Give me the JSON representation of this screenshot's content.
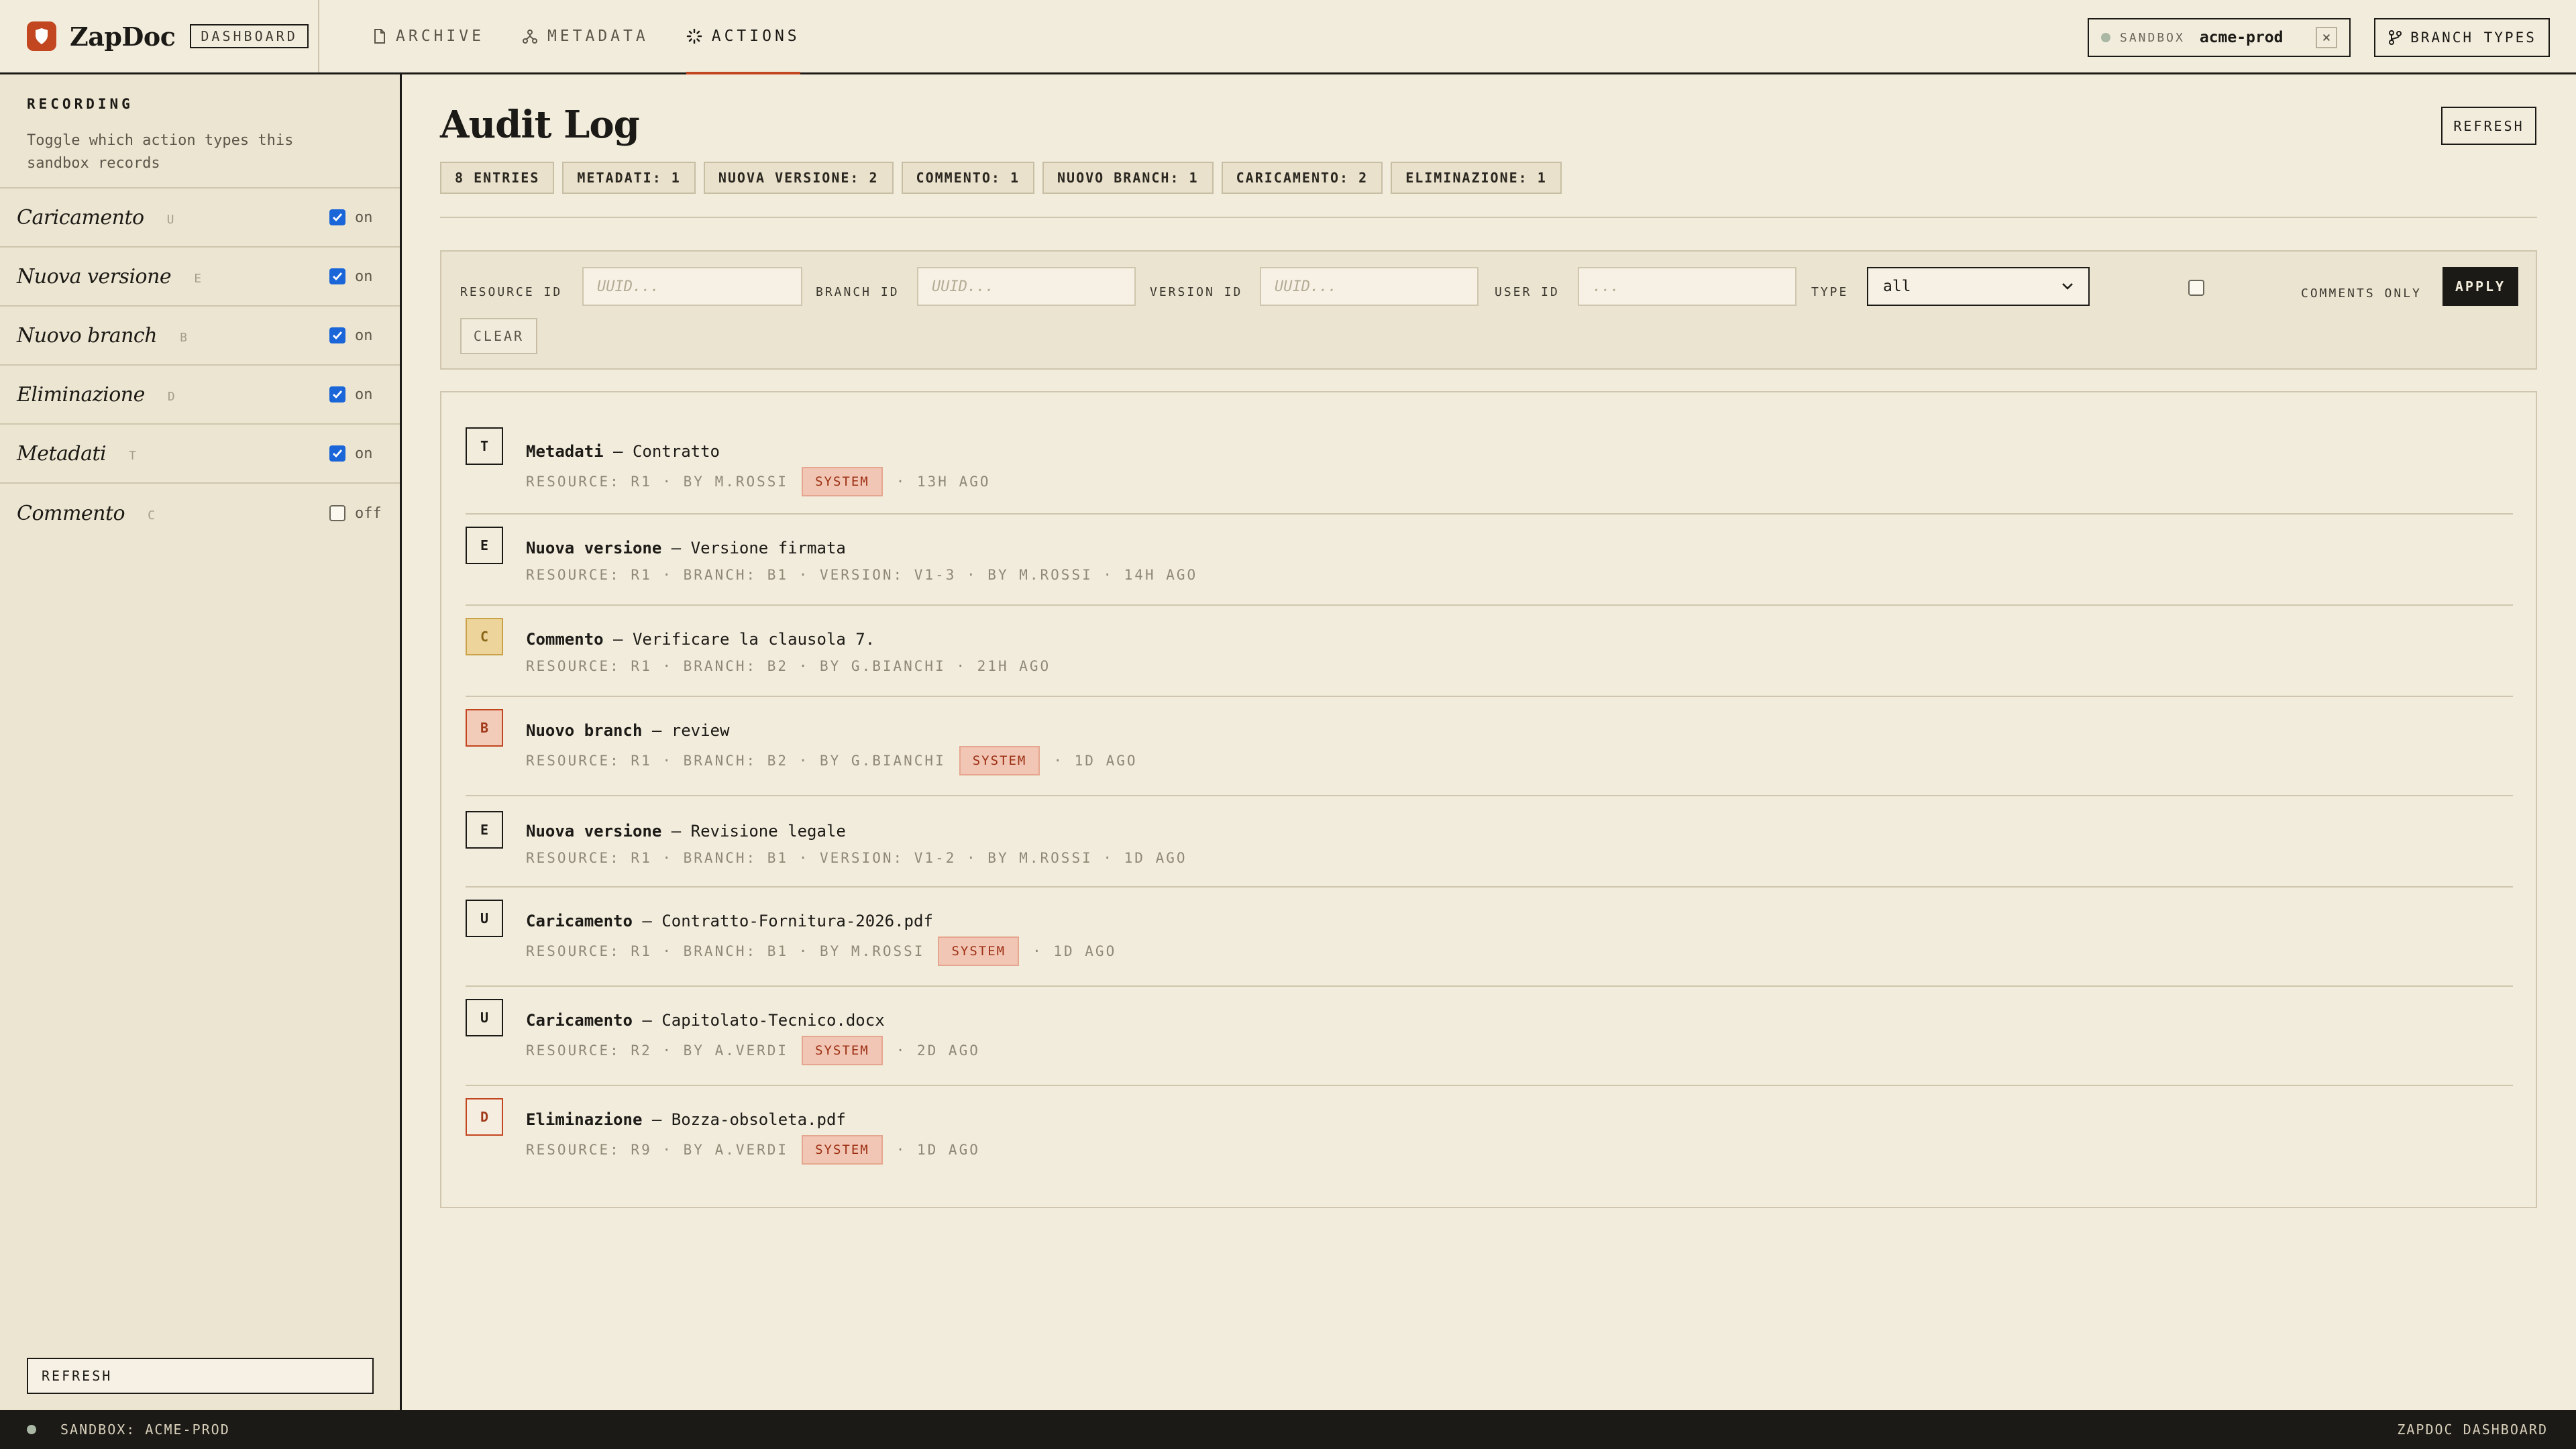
{
  "header": {
    "brand": "ZapDoc",
    "badge": "DASHBOARD",
    "nav": [
      {
        "label": "ARCHIVE",
        "icon": "file-icon"
      },
      {
        "label": "METADATA",
        "icon": "branch-nodes-icon"
      },
      {
        "label": "ACTIONS",
        "icon": "spinner-icon",
        "active": true
      }
    ],
    "sandbox_label": "SANDBOX",
    "sandbox_value": "acme-prod",
    "sandbox_close": "×",
    "branch_types": "BRANCH TYPES"
  },
  "sidebar": {
    "title": "RECORDING",
    "description": "Toggle which action types this sandbox records",
    "toggles": [
      {
        "name": "Caricamento",
        "key": "U",
        "checked": true,
        "state": "on"
      },
      {
        "name": "Nuova versione",
        "key": "E",
        "checked": true,
        "state": "on"
      },
      {
        "name": "Nuovo branch",
        "key": "B",
        "checked": true,
        "state": "on"
      },
      {
        "name": "Eliminazione",
        "key": "D",
        "checked": true,
        "state": "on"
      },
      {
        "name": "Metadati",
        "key": "T",
        "checked": true,
        "state": "on"
      },
      {
        "name": "Commento",
        "key": "C",
        "checked": false,
        "state": "off"
      }
    ],
    "refresh": "REFRESH"
  },
  "main": {
    "title": "Audit Log",
    "refresh": "REFRESH",
    "stats": [
      "8 ENTRIES",
      "METADATI: 1",
      "NUOVA VERSIONE: 2",
      "COMMENTO: 1",
      "NUOVO BRANCH: 1",
      "CARICAMENTO: 2",
      "ELIMINAZIONE: 1"
    ],
    "filters": {
      "resource_id_label": "RESOURCE ID",
      "resource_id_placeholder": "UUID...",
      "branch_id_label": "BRANCH ID",
      "branch_id_placeholder": "UUID...",
      "version_id_label": "VERSION ID",
      "version_id_placeholder": "UUID...",
      "user_id_label": "USER ID",
      "user_id_placeholder": "...",
      "type_label": "TYPE",
      "type_value": "all",
      "comments_only_label": "COMMENTS ONLY",
      "comments_only_checked": false,
      "apply": "APPLY",
      "clear": "CLEAR"
    },
    "entries": [
      {
        "icon_letter": "T",
        "kind": "default",
        "type": "Metadati",
        "subject": "Contratto",
        "meta": "RESOURCE: R1 · BY M.ROSSI",
        "system": "SYSTEM",
        "age": "· 13H AGO"
      },
      {
        "icon_letter": "E",
        "kind": "default",
        "type": "Nuova versione",
        "subject": "Versione firmata",
        "meta": "RESOURCE: R1 · BRANCH: B1 · VERSION: V1-3 · BY M.ROSSI · 14H AGO",
        "system": "",
        "age": ""
      },
      {
        "icon_letter": "C",
        "kind": "comment",
        "type": "Commento",
        "subject": "Verificare la clausola 7.",
        "meta": "RESOURCE: R1 · BRANCH: B2 · BY G.BIANCHI · 21H AGO",
        "system": "",
        "age": ""
      },
      {
        "icon_letter": "B",
        "kind": "branch",
        "type": "Nuovo branch",
        "subject": "review",
        "meta": "RESOURCE: R1 · BRANCH: B2 · BY G.BIANCHI",
        "system": "SYSTEM",
        "age": "· 1D AGO"
      },
      {
        "icon_letter": "E",
        "kind": "default",
        "type": "Nuova versione",
        "subject": "Revisione legale",
        "meta": "RESOURCE: R1 · BRANCH: B1 · VERSION: V1-2 · BY M.ROSSI · 1D AGO",
        "system": "",
        "age": ""
      },
      {
        "icon_letter": "U",
        "kind": "upload",
        "type": "Caricamento",
        "subject": "Contratto-Fornitura-2026.pdf",
        "meta": "RESOURCE: R1 · BRANCH: B1 · BY M.ROSSI",
        "system": "SYSTEM",
        "age": "· 1D AGO"
      },
      {
        "icon_letter": "U",
        "kind": "upload",
        "type": "Caricamento",
        "subject": "Capitolato-Tecnico.docx",
        "meta": "RESOURCE: R2 · BY A.VERDI",
        "system": "SYSTEM",
        "age": "· 2D AGO"
      },
      {
        "icon_letter": "D",
        "kind": "delete",
        "type": "Eliminazione",
        "subject": "Bozza-obsoleta.pdf",
        "meta": "RESOURCE: R9 · BY A.VERDI",
        "system": "SYSTEM",
        "age": "· 1D AGO"
      }
    ]
  },
  "footer": {
    "left": "SANDBOX: ACME-PROD",
    "right": "ZAPDOC DASHBOARD"
  },
  "colors": {
    "background": "#f2ecdc",
    "accent": "#c2461f",
    "ink": "#1c1a16",
    "checkbox": "#1a66d9",
    "system_badge": "#f2c6b5"
  }
}
